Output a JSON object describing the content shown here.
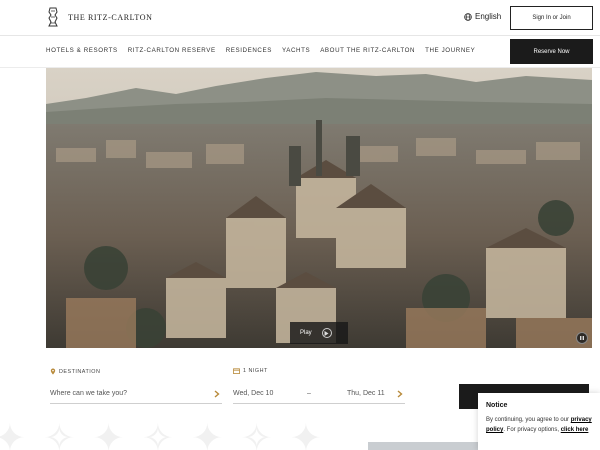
{
  "header": {
    "brand": "THE RITZ-CARLTON",
    "language": "English",
    "signin_label": "Sign In or Join",
    "reserve_label": "Reserve Now"
  },
  "nav": {
    "items": [
      {
        "label": "HOTELS & RESORTS"
      },
      {
        "label": "RITZ-CARLTON RESERVE"
      },
      {
        "label": "RESIDENCES"
      },
      {
        "label": "YACHTS"
      },
      {
        "label": "ABOUT THE RITZ-CARLTON"
      },
      {
        "label": "THE JOURNEY"
      }
    ]
  },
  "hero": {
    "play_label": "Play"
  },
  "booking": {
    "destination_label": "DESTINATION",
    "destination_placeholder": "Where can we take you?",
    "nights_label": "1 NIGHT",
    "checkin": "Wed, Dec 10",
    "separator": "–",
    "checkout": "Thu, Dec 11"
  },
  "notice": {
    "title": "Notice",
    "text_before": "By continuing, you agree to our ",
    "privacy_link": "privacy policy",
    "text_middle": ". For privacy options, ",
    "click_link": "click here"
  },
  "colors": {
    "dark": "#1b1b1b",
    "border": "#222222",
    "divider": "#e6e6e6"
  }
}
